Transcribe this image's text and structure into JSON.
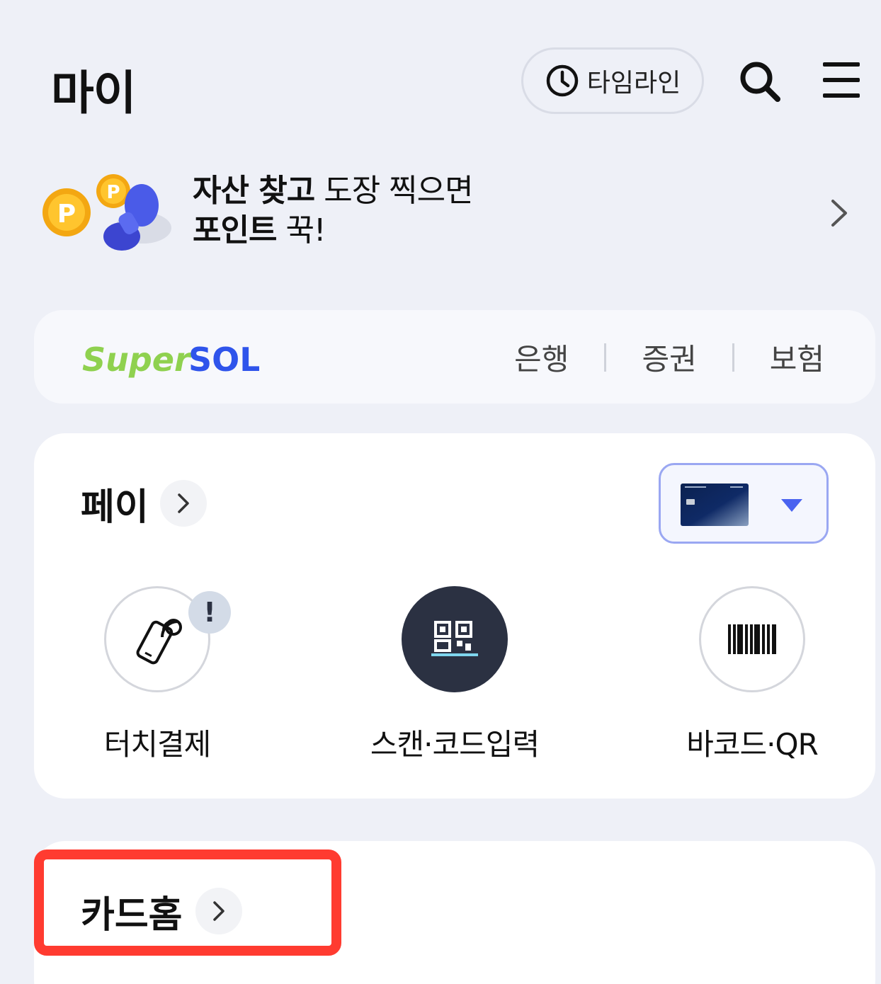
{
  "header": {
    "title": "마이",
    "timeline_label": "타임라인",
    "icons": [
      "clock-icon",
      "search-icon",
      "hamburger-menu-icon"
    ]
  },
  "promo": {
    "line1_bold": "자산 찾고",
    "line1_regular": " 도장 찍으면",
    "line2_bold": "포인트",
    "line2_regular": " 꾹!",
    "coin_letter": "P"
  },
  "supersol": {
    "logo_super": "Super",
    "logo_sol": "SOL",
    "links": [
      "은행",
      "증권",
      "보험"
    ]
  },
  "pay": {
    "title": "페이",
    "actions": [
      {
        "label": "터치결제",
        "icon": "phone-nfc-icon",
        "badge": "!"
      },
      {
        "label": "스캔·코드입력",
        "icon": "qr-scan-icon"
      },
      {
        "label": "바코드·QR",
        "icon": "barcode-icon"
      }
    ]
  },
  "cardhome": {
    "title": "카드홈"
  },
  "colors": {
    "background": "#eef0f7",
    "accent_blue": "#4a63f0",
    "highlight_red": "#ff3b30",
    "dark_circle": "#2b3142",
    "logo_green": "#8fd14f",
    "logo_blue": "#2f54eb"
  }
}
